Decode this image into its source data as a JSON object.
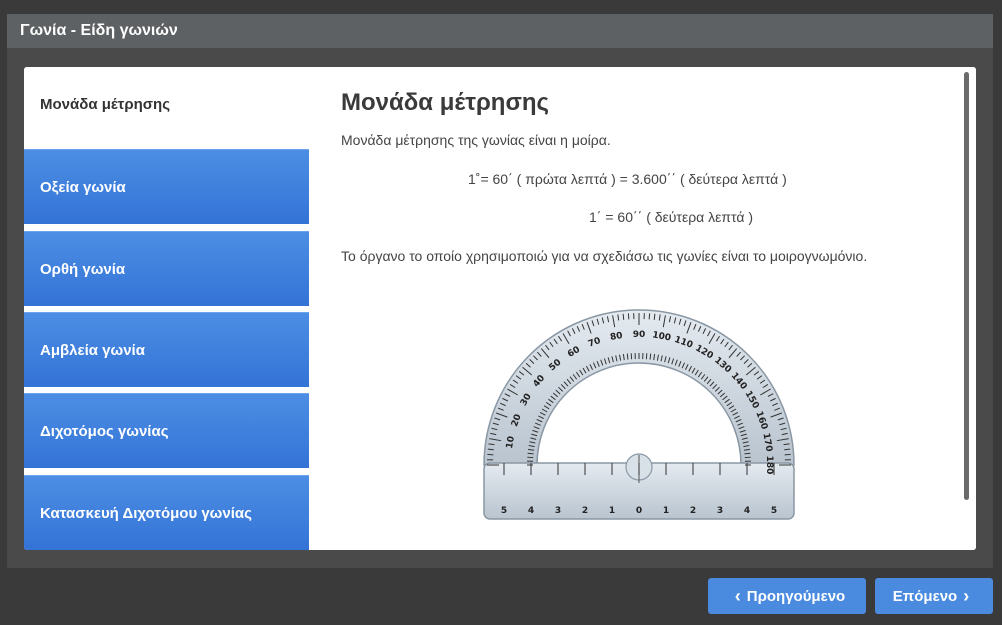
{
  "window": {
    "title": "Γωνία - Είδη γωνιών"
  },
  "sidebar": {
    "items": [
      {
        "label": "Μονάδα μέτρησης"
      },
      {
        "label": "Οξεία γωνία"
      },
      {
        "label": "Ορθή γωνία"
      },
      {
        "label": "Αμβλεία γωνία"
      },
      {
        "label": "Διχοτόμος γωνίας"
      },
      {
        "label": "Κατασκευή Διχοτόμου γωνίας"
      }
    ]
  },
  "content": {
    "heading": "Μονάδα μέτρησης",
    "paragraph1": "Μονάδα μέτρησης της γωνίας είναι η μοίρα.",
    "formula1": "1˚= 60΄ ( πρώτα λεπτά ) = 3.600΄΄ ( δεύτερα λεπτά )",
    "formula2": "1΄ =   60΄΄ ( δεύτερα λεπτά )",
    "paragraph2": "Το όργανο το οποίο χρησιμοποιώ για να σχεδιάσω τις γωνίες είναι το μοιρογνωμόνιο."
  },
  "protractor": {
    "outer_scale": [
      "10",
      "20",
      "30",
      "40",
      "50",
      "60",
      "70",
      "80",
      "90",
      "100",
      "110",
      "120",
      "130",
      "140",
      "150",
      "160",
      "170",
      "180"
    ],
    "ruler_marks": [
      "5",
      "4",
      "3",
      "2",
      "1",
      "0",
      "1",
      "2",
      "3",
      "4",
      "5"
    ]
  },
  "nav": {
    "prev_label": "Προηγούμενο",
    "next_label": "Επόμενο"
  },
  "colors": {
    "accent": "#4a8be0",
    "titlebar": "#5e6163"
  }
}
